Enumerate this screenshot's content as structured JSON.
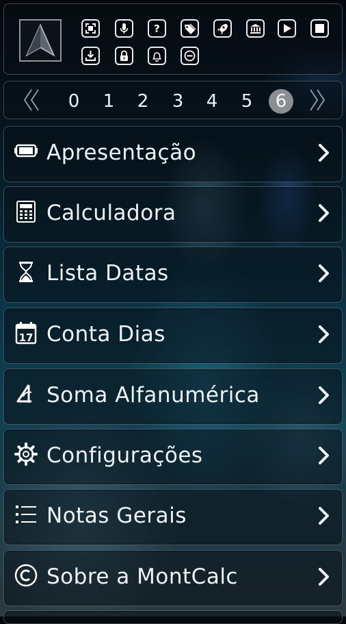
{
  "toolbar": {
    "icons_row1": [
      "fullscreen-icon",
      "microphone-icon",
      "help-icon",
      "tags-icon",
      "rocket-icon",
      "bank-icon",
      "play-icon",
      "stop-icon"
    ],
    "icons_row2": [
      "download-icon",
      "lock-icon",
      "bell-icon",
      "minus-circle-icon"
    ]
  },
  "pager": {
    "pages": [
      "0",
      "1",
      "2",
      "3",
      "4",
      "5",
      "6"
    ],
    "active": "6"
  },
  "menu": {
    "items": [
      {
        "label": "Apresentação",
        "icon": "presentation-icon"
      },
      {
        "label": "Calculadora",
        "icon": "calculator-icon"
      },
      {
        "label": "Lista Datas",
        "icon": "hourglass-icon"
      },
      {
        "label": "Conta Dias",
        "icon": "calendar-icon"
      },
      {
        "label": "Soma Alfanumérica",
        "icon": "alpha-sum-icon"
      },
      {
        "label": "Configurações",
        "icon": "gear-icon"
      },
      {
        "label": "Notas Gerais",
        "icon": "list-icon"
      },
      {
        "label": "Sobre a MontCalc",
        "icon": "copyright-icon"
      }
    ]
  },
  "colors": {
    "accent_white": "#eef3f6",
    "active_page": "#8b8f92",
    "panel_border": "#aabecd"
  }
}
